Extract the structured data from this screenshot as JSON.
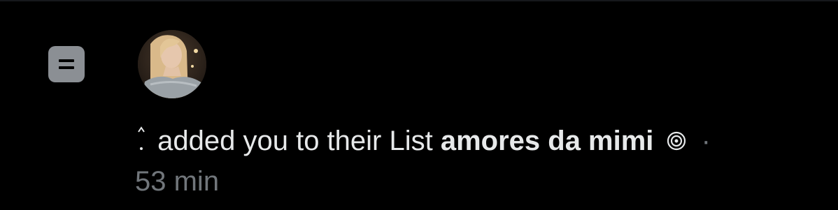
{
  "notification": {
    "type_icon": "list-icon",
    "sender_avatar": "avatar",
    "sender_name_icon": "sparkle-name-icon",
    "action_text": "added you to their List",
    "list_name": "amores da mimi",
    "list_name_emoji_icon": "swirl-icon",
    "separator": "·",
    "timestamp": "53 min"
  },
  "colors": {
    "background": "#000000",
    "primary_text": "#e7e9ea",
    "secondary_text": "#71767b",
    "icon_fill": "#8b8f94"
  }
}
